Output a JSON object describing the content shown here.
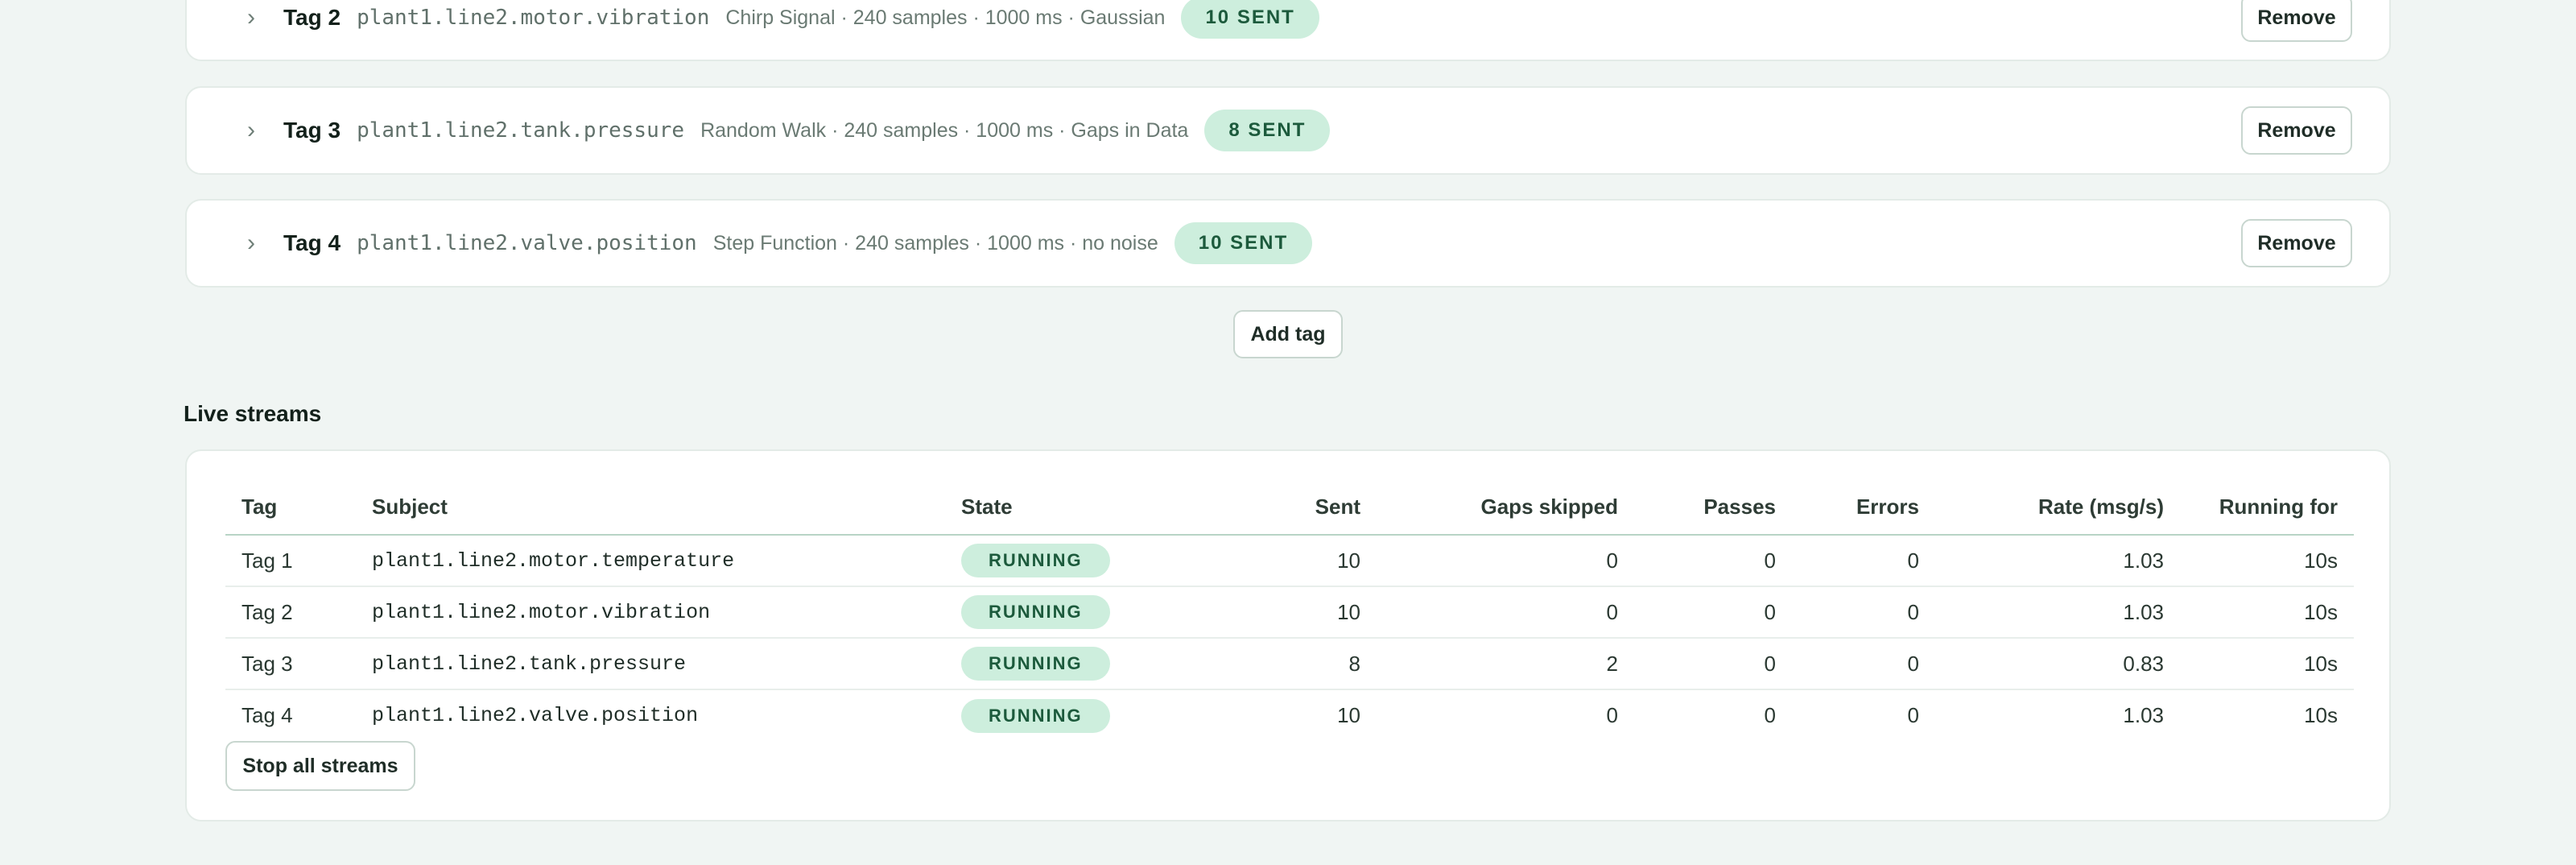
{
  "tags": [
    {
      "title": "Tag 2",
      "subject": "plant1.line2.motor.vibration",
      "meta": "Chirp Signal · 240 samples · 1000 ms · Gaussian",
      "sent": "10 SENT",
      "remove_label": "Remove"
    },
    {
      "title": "Tag 3",
      "subject": "plant1.line2.tank.pressure",
      "meta": "Random Walk · 240 samples · 1000 ms · Gaps in Data",
      "sent": "8 SENT",
      "remove_label": "Remove"
    },
    {
      "title": "Tag 4",
      "subject": "plant1.line2.valve.position",
      "meta": "Step Function · 240 samples · 1000 ms · no noise",
      "sent": "10 SENT",
      "remove_label": "Remove"
    }
  ],
  "add_tag_label": "Add tag",
  "streams": {
    "title": "Live streams",
    "columns": [
      "Tag",
      "Subject",
      "State",
      "Sent",
      "Gaps skipped",
      "Passes",
      "Errors",
      "Rate (msg/s)",
      "Running for"
    ],
    "rows": [
      {
        "tag": "Tag 1",
        "subject": "plant1.line2.motor.temperature",
        "state": "RUNNING",
        "sent": "10",
        "gaps": "0",
        "passes": "0",
        "errors": "0",
        "rate": "1.03",
        "running": "10s"
      },
      {
        "tag": "Tag 2",
        "subject": "plant1.line2.motor.vibration",
        "state": "RUNNING",
        "sent": "10",
        "gaps": "0",
        "passes": "0",
        "errors": "0",
        "rate": "1.03",
        "running": "10s"
      },
      {
        "tag": "Tag 3",
        "subject": "plant1.line2.tank.pressure",
        "state": "RUNNING",
        "sent": "8",
        "gaps": "2",
        "passes": "0",
        "errors": "0",
        "rate": "0.83",
        "running": "10s"
      },
      {
        "tag": "Tag 4",
        "subject": "plant1.line2.valve.position",
        "state": "RUNNING",
        "sent": "10",
        "gaps": "0",
        "passes": "0",
        "errors": "0",
        "rate": "1.03",
        "running": "10s"
      }
    ],
    "stop_label": "Stop all streams"
  },
  "icons": {
    "expand": "chevron-right-icon"
  },
  "colors": {
    "background": "#f0f5f3",
    "badge_bg": "#cdeedd",
    "badge_text": "#1c5a3c"
  }
}
